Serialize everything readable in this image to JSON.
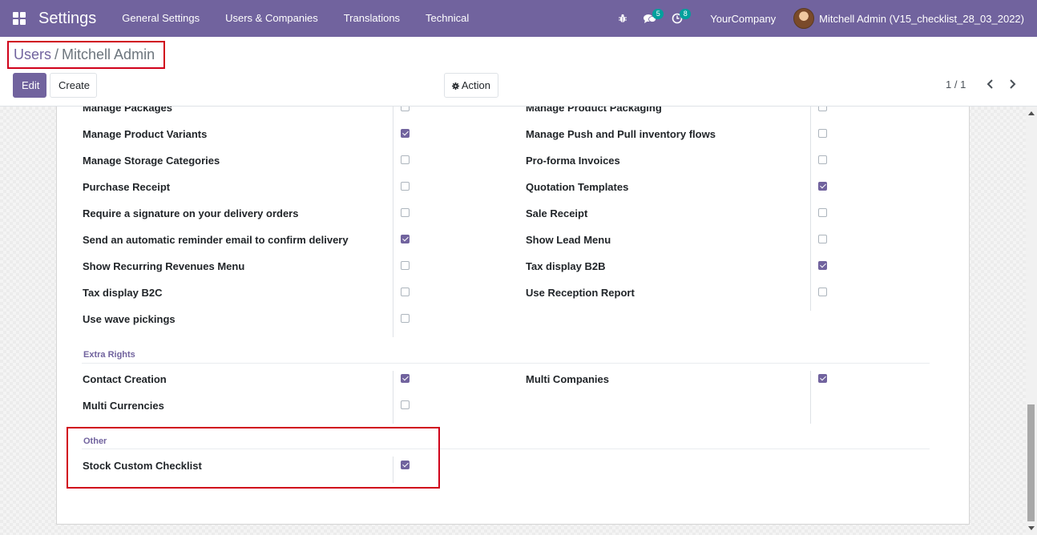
{
  "navbar": {
    "brand": "Settings",
    "menu": [
      "General Settings",
      "Users & Companies",
      "Translations",
      "Technical"
    ],
    "icons": {
      "apps": "apps-grid-icon",
      "debug": "bug-icon",
      "messages": "chat-icon",
      "activities": "clock-icon"
    },
    "messages_count": "5",
    "activities_count": "8",
    "company": "YourCompany",
    "user": "Mitchell Admin (V15_checklist_28_03_2022)"
  },
  "breadcrumb": {
    "parent": "Users",
    "separator": "/",
    "current": "Mitchell Admin"
  },
  "buttons": {
    "edit": "Edit",
    "create": "Create",
    "action": "Action"
  },
  "pager": {
    "value": "1 / 1"
  },
  "rights_left": [
    {
      "label": "Manage Packages",
      "checked": false
    },
    {
      "label": "Manage Product Variants",
      "checked": true
    },
    {
      "label": "Manage Storage Categories",
      "checked": false
    },
    {
      "label": "Purchase Receipt",
      "checked": false
    },
    {
      "label": "Require a signature on your delivery orders",
      "checked": false
    },
    {
      "label": "Send an automatic reminder email to confirm delivery",
      "checked": true
    },
    {
      "label": "Show Recurring Revenues Menu",
      "checked": false
    },
    {
      "label": "Tax display B2C",
      "checked": false
    },
    {
      "label": "Use wave pickings",
      "checked": false
    }
  ],
  "rights_right": [
    {
      "label": "Manage Product Packaging",
      "checked": false
    },
    {
      "label": "Manage Push and Pull inventory flows",
      "checked": false
    },
    {
      "label": "Pro-forma Invoices",
      "checked": false
    },
    {
      "label": "Quotation Templates",
      "checked": true
    },
    {
      "label": "Sale Receipt",
      "checked": false
    },
    {
      "label": "Show Lead Menu",
      "checked": false
    },
    {
      "label": "Tax display B2B",
      "checked": true
    },
    {
      "label": "Use Reception Report",
      "checked": false
    }
  ],
  "extra_rights": {
    "title": "Extra Rights",
    "left": [
      {
        "label": "Contact Creation",
        "checked": true
      },
      {
        "label": "Multi Currencies",
        "checked": false
      }
    ],
    "right": [
      {
        "label": "Multi Companies",
        "checked": true
      }
    ]
  },
  "other": {
    "title": "Other",
    "left": [
      {
        "label": "Stock Custom Checklist",
        "checked": true
      }
    ]
  },
  "colors": {
    "primary": "#71639e",
    "highlight": "#d0021b",
    "badge": "#00a09d"
  }
}
